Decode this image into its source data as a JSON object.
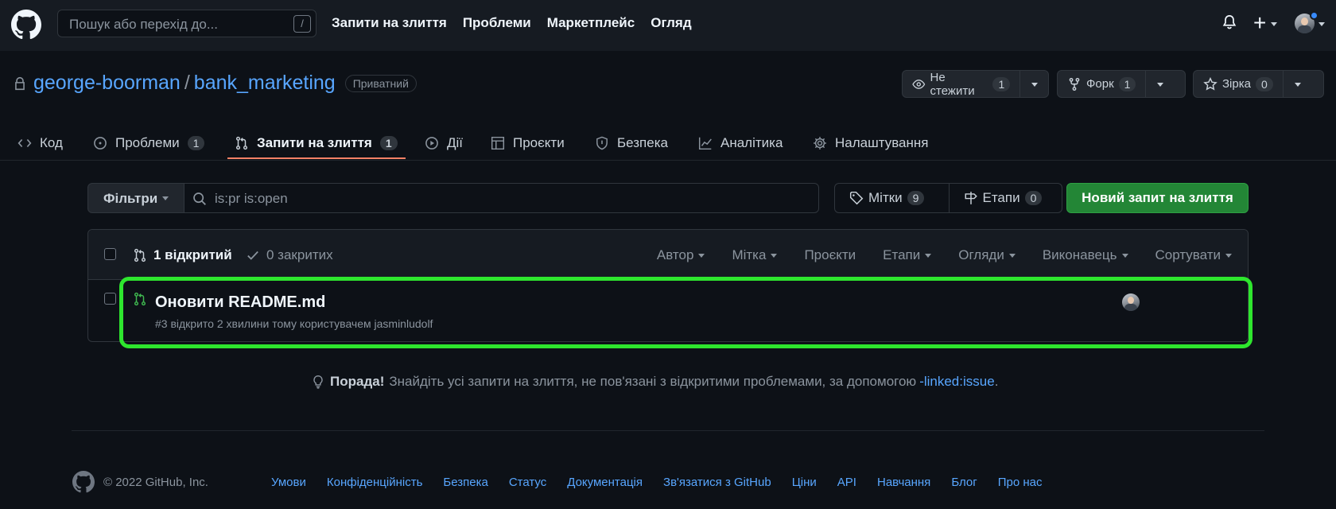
{
  "header": {
    "search_placeholder": "Пошук або перехід до...",
    "search_shortcut": "/",
    "nav": [
      "Запити на злиття",
      "Проблеми",
      "Маркетплейс",
      "Огляд"
    ]
  },
  "repo": {
    "owner": "george-boorman",
    "separator": "/",
    "name": "bank_marketing",
    "visibility": "Приватний",
    "watch": {
      "label": "Не стежити",
      "count": "1"
    },
    "fork": {
      "label": "Форк",
      "count": "1"
    },
    "star": {
      "label": "Зірка",
      "count": "0"
    }
  },
  "tabs": [
    {
      "label": "Код"
    },
    {
      "label": "Проблеми",
      "count": "1"
    },
    {
      "label": "Запити на злиття",
      "count": "1",
      "active": true
    },
    {
      "label": "Дії"
    },
    {
      "label": "Проєкти"
    },
    {
      "label": "Безпека"
    },
    {
      "label": "Аналітика"
    },
    {
      "label": "Налаштування"
    }
  ],
  "filters": {
    "button": "Фільтри",
    "query": "is:pr is:open",
    "labels": {
      "label": "Мітки",
      "count": "9"
    },
    "milestones": {
      "label": "Етапи",
      "count": "0"
    },
    "new_pr": "Новий запит на злиття"
  },
  "list": {
    "open_label": "1 відкритий",
    "closed_label": "0 закритих",
    "header_filters": [
      "Автор",
      "Мітка",
      "Проєкти",
      "Етапи",
      "Огляди",
      "Виконавець",
      "Сортувати"
    ],
    "items": [
      {
        "title": "Оновити README.md",
        "meta": "#3 відкрито 2 хвилини тому користувачем jasminludolf"
      }
    ]
  },
  "tip": {
    "bold": "Порада!",
    "text": "Знайдіть усі запити на злиття, не пов'язані з відкритими проблемами, за допомогою",
    "link": "-linked:issue",
    "end": "."
  },
  "footer": {
    "copyright": "© 2022 GitHub, Inc.",
    "links": [
      "Умови",
      "Конфіденційність",
      "Безпека",
      "Статус",
      "Документація",
      "Зв'язатися з GitHub",
      "Ціни",
      "API",
      "Навчання",
      "Блог",
      "Про нас"
    ]
  },
  "colors": {
    "accent_green": "#238636",
    "link_blue": "#58a6ff",
    "highlight": "#2ee62e",
    "tab_underline": "#f78166"
  }
}
